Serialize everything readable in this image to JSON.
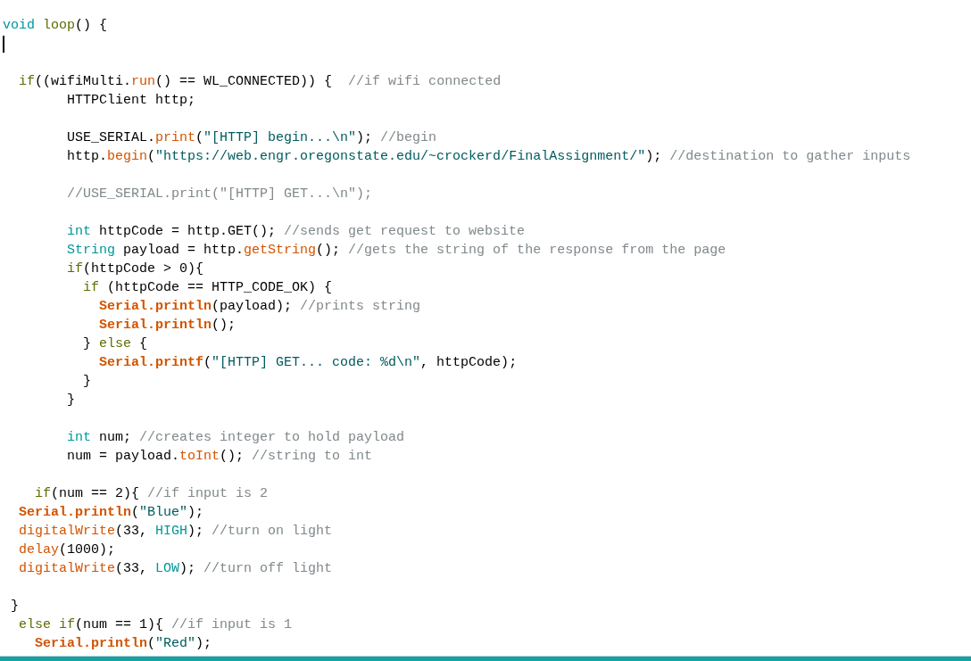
{
  "editor": {
    "lines": [
      {
        "kind": "code",
        "tokens": [
          {
            "kind": "type",
            "text": "void"
          },
          {
            "kind": "control",
            "text": " loop"
          },
          {
            "kind": "plain",
            "text": "() {"
          }
        ]
      },
      {
        "kind": "cursor"
      },
      {
        "kind": "blank"
      },
      {
        "kind": "code",
        "tokens": [
          {
            "kind": "control",
            "text": "  if"
          },
          {
            "kind": "plain",
            "text": "((wifiMulti."
          },
          {
            "kind": "function",
            "text": "run"
          },
          {
            "kind": "plain",
            "text": "() == WL_CONNECTED)) {  "
          },
          {
            "kind": "comment",
            "text": "//if wifi connected"
          }
        ]
      },
      {
        "kind": "code",
        "tokens": [
          {
            "kind": "plain",
            "text": "        HTTPClient http;"
          }
        ]
      },
      {
        "kind": "blank"
      },
      {
        "kind": "code",
        "tokens": [
          {
            "kind": "plain",
            "text": "        USE_SERIAL."
          },
          {
            "kind": "function",
            "text": "print"
          },
          {
            "kind": "plain",
            "text": "("
          },
          {
            "kind": "string",
            "text": "\"[HTTP] begin...\\n\""
          },
          {
            "kind": "plain",
            "text": "); "
          },
          {
            "kind": "comment",
            "text": "//begin"
          }
        ]
      },
      {
        "kind": "code",
        "tokens": [
          {
            "kind": "plain",
            "text": "        http."
          },
          {
            "kind": "function",
            "text": "begin"
          },
          {
            "kind": "plain",
            "text": "("
          },
          {
            "kind": "string",
            "text": "\"https://web.engr.oregonstate.edu/~crockerd/FinalAssignment/\""
          },
          {
            "kind": "plain",
            "text": "); "
          },
          {
            "kind": "comment",
            "text": "//destination to gather inputs"
          }
        ]
      },
      {
        "kind": "blank"
      },
      {
        "kind": "code",
        "tokens": [
          {
            "kind": "comment",
            "text": "        //USE_SERIAL.print(\"[HTTP] GET...\\n\");"
          }
        ]
      },
      {
        "kind": "blank"
      },
      {
        "kind": "code",
        "tokens": [
          {
            "kind": "type",
            "text": "        int"
          },
          {
            "kind": "plain",
            "text": " httpCode = http.GET(); "
          },
          {
            "kind": "comment",
            "text": "//sends get request to website"
          }
        ]
      },
      {
        "kind": "code",
        "tokens": [
          {
            "kind": "type",
            "text": "        String"
          },
          {
            "kind": "plain",
            "text": " payload = http."
          },
          {
            "kind": "function",
            "text": "getString"
          },
          {
            "kind": "plain",
            "text": "(); "
          },
          {
            "kind": "comment",
            "text": "//gets the string of the response from the page"
          }
        ]
      },
      {
        "kind": "code",
        "tokens": [
          {
            "kind": "control",
            "text": "        if"
          },
          {
            "kind": "plain",
            "text": "(httpCode > 0){"
          }
        ]
      },
      {
        "kind": "code",
        "tokens": [
          {
            "kind": "control",
            "text": "          if"
          },
          {
            "kind": "plain",
            "text": " (httpCode == HTTP_CODE_OK) {"
          }
        ]
      },
      {
        "kind": "code",
        "tokens": [
          {
            "kind": "object",
            "text": "            Serial.println"
          },
          {
            "kind": "plain",
            "text": "(payload); "
          },
          {
            "kind": "comment",
            "text": "//prints string"
          }
        ]
      },
      {
        "kind": "code",
        "tokens": [
          {
            "kind": "object",
            "text": "            Serial.println"
          },
          {
            "kind": "plain",
            "text": "();"
          }
        ]
      },
      {
        "kind": "code",
        "tokens": [
          {
            "kind": "plain",
            "text": "          } "
          },
          {
            "kind": "control",
            "text": "else"
          },
          {
            "kind": "plain",
            "text": " {"
          }
        ]
      },
      {
        "kind": "code",
        "tokens": [
          {
            "kind": "object",
            "text": "            Serial.printf"
          },
          {
            "kind": "plain",
            "text": "("
          },
          {
            "kind": "string",
            "text": "\"[HTTP] GET... code: %d\\n\""
          },
          {
            "kind": "plain",
            "text": ", httpCode);"
          }
        ]
      },
      {
        "kind": "code",
        "tokens": [
          {
            "kind": "plain",
            "text": "          }"
          }
        ]
      },
      {
        "kind": "code",
        "tokens": [
          {
            "kind": "plain",
            "text": "        }"
          }
        ]
      },
      {
        "kind": "blank"
      },
      {
        "kind": "code",
        "tokens": [
          {
            "kind": "type",
            "text": "        int"
          },
          {
            "kind": "plain",
            "text": " num; "
          },
          {
            "kind": "comment",
            "text": "//creates integer to hold payload"
          }
        ]
      },
      {
        "kind": "code",
        "tokens": [
          {
            "kind": "plain",
            "text": "        num = payload."
          },
          {
            "kind": "function",
            "text": "toInt"
          },
          {
            "kind": "plain",
            "text": "(); "
          },
          {
            "kind": "comment",
            "text": "//string to int"
          }
        ]
      },
      {
        "kind": "blank"
      },
      {
        "kind": "code",
        "tokens": [
          {
            "kind": "control",
            "text": "    if"
          },
          {
            "kind": "plain",
            "text": "(num == 2){ "
          },
          {
            "kind": "comment",
            "text": "//if input is 2"
          }
        ]
      },
      {
        "kind": "code",
        "tokens": [
          {
            "kind": "object",
            "text": "  Serial.println"
          },
          {
            "kind": "plain",
            "text": "("
          },
          {
            "kind": "string",
            "text": "\"Blue\""
          },
          {
            "kind": "plain",
            "text": ");"
          }
        ]
      },
      {
        "kind": "code",
        "tokens": [
          {
            "kind": "function",
            "text": "  digitalWrite"
          },
          {
            "kind": "plain",
            "text": "(33, "
          },
          {
            "kind": "constant",
            "text": "HIGH"
          },
          {
            "kind": "plain",
            "text": "); "
          },
          {
            "kind": "comment",
            "text": "//turn on light"
          }
        ]
      },
      {
        "kind": "code",
        "tokens": [
          {
            "kind": "function",
            "text": "  delay"
          },
          {
            "kind": "plain",
            "text": "(1000);"
          }
        ]
      },
      {
        "kind": "code",
        "tokens": [
          {
            "kind": "function",
            "text": "  digitalWrite"
          },
          {
            "kind": "plain",
            "text": "(33, "
          },
          {
            "kind": "constant",
            "text": "LOW"
          },
          {
            "kind": "plain",
            "text": "); "
          },
          {
            "kind": "comment",
            "text": "//turn off light"
          }
        ]
      },
      {
        "kind": "blank"
      },
      {
        "kind": "code",
        "tokens": [
          {
            "kind": "plain",
            "text": " }"
          }
        ]
      },
      {
        "kind": "code",
        "tokens": [
          {
            "kind": "control",
            "text": "  else if"
          },
          {
            "kind": "plain",
            "text": "(num == 1){ "
          },
          {
            "kind": "comment",
            "text": "//if input is 1"
          }
        ]
      },
      {
        "kind": "code",
        "tokens": [
          {
            "kind": "object",
            "text": "    Serial.println"
          },
          {
            "kind": "plain",
            "text": "("
          },
          {
            "kind": "string",
            "text": "\"Red\""
          },
          {
            "kind": "plain",
            "text": ");"
          }
        ]
      }
    ]
  }
}
